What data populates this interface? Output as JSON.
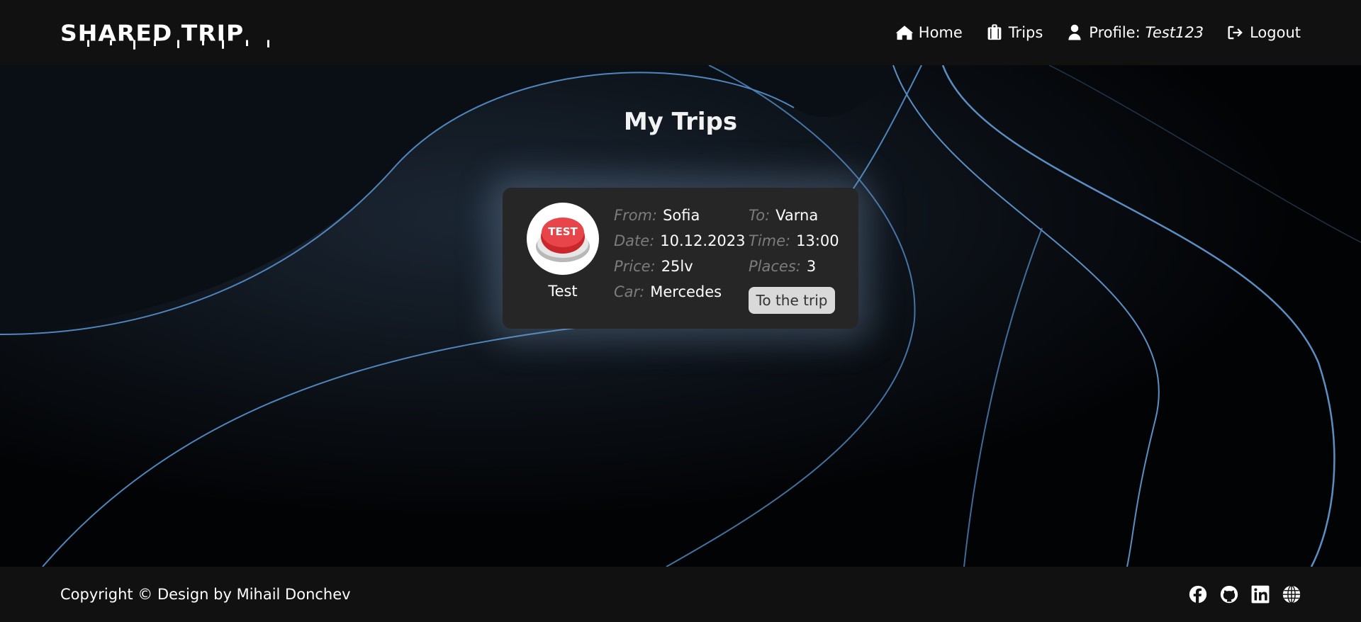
{
  "header": {
    "logo_text": "SHARED TRIP",
    "nav": {
      "home": "Home",
      "trips": "Trips",
      "profile_label": "Profile:",
      "profile_user": "Test123",
      "logout": "Logout"
    }
  },
  "main": {
    "title": "My Trips",
    "trip": {
      "driver_name": "Test",
      "avatar_text": "TEST",
      "from_label": "From:",
      "from_value": "Sofia",
      "to_label": "To:",
      "to_value": "Varna",
      "date_label": "Date:",
      "date_value": "10.12.2023",
      "time_label": "Time:",
      "time_value": "13:00",
      "price_label": "Price:",
      "price_value": "25lv",
      "places_label": "Places:",
      "places_value": "3",
      "car_label": "Car:",
      "car_value": "Mercedes",
      "button_label": "To the trip"
    }
  },
  "footer": {
    "copyright": "Copyright © Design by Mihail Donchev",
    "socials": [
      "facebook-icon",
      "github-icon",
      "linkedin-icon",
      "globe-icon"
    ]
  },
  "colors": {
    "header_bg": "#111111",
    "card_bg": "#262626",
    "wave_line": "#5b8fc4",
    "button_bg": "#d9d9d9"
  }
}
